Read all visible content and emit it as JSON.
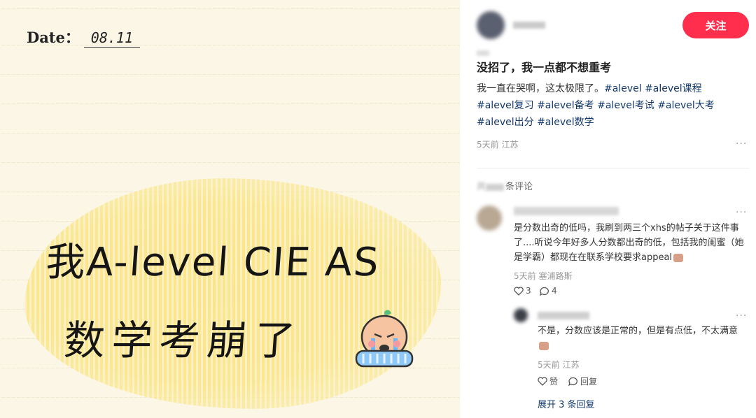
{
  "image": {
    "date_label": "Date：",
    "date_value": "08.11",
    "line1": "我A-level CIE AS",
    "line2": "数学考崩了"
  },
  "post": {
    "follow_label": "关注",
    "title": "没招了，我一点都不想重考",
    "body_text": "我一直在哭啊，这太极限了。",
    "tags": [
      "#alevel",
      "#alevel课程",
      "#alevel复习",
      "#alevel备考",
      "#alevel考试",
      "#alevel大考",
      "#alevel出分",
      "#alevel数学"
    ],
    "time": "5天前",
    "location": "江苏",
    "more": "···"
  },
  "comments": {
    "count_label": "条评论",
    "count_prefix": "共",
    "items": [
      {
        "text": "是分数出奇的低吗，我刷到两三个xhs的帖子关于这件事了....听说今年好多人分数都出奇的低，包括我的闺蜜（她是学霸）都现在在联系学校要求appeal",
        "time": "5天前",
        "location": "塞浦路斯",
        "likes": "3",
        "replies": "4"
      },
      {
        "text": "不是，分数应该是正常的，但是有点低，不太满意",
        "time": "5天前",
        "location": "江苏",
        "like_label": "赞",
        "reply_label": "回复"
      }
    ],
    "expand_label": "展开 3 条回复"
  },
  "colors": {
    "accent": "#ff2e4d",
    "tag": "#13386c",
    "paper": "#fbf6e6",
    "highlight": "#fbe58a"
  }
}
